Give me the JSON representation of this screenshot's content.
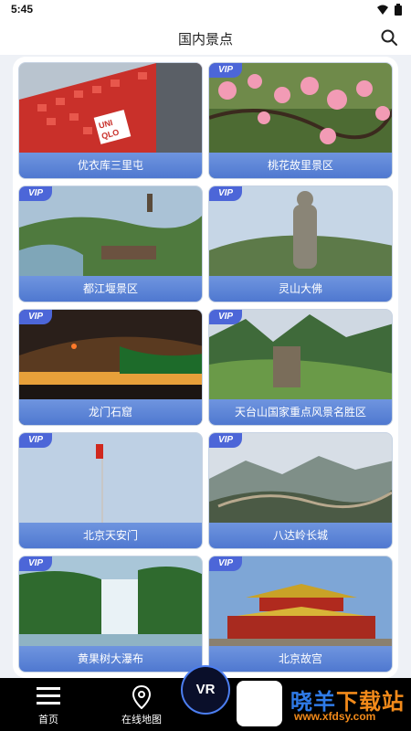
{
  "status_bar": {
    "time": "5:45"
  },
  "header": {
    "title": "国内景点"
  },
  "cards": [
    {
      "label": "优衣库三里屯",
      "vip": ""
    },
    {
      "label": "桃花故里景区",
      "vip": "VIP"
    },
    {
      "label": "都江堰景区",
      "vip": "VIP"
    },
    {
      "label": "灵山大佛",
      "vip": "VIP"
    },
    {
      "label": "龙门石窟",
      "vip": "VIP"
    },
    {
      "label": "天台山国家重点风景名胜区",
      "vip": "VIP"
    },
    {
      "label": "北京天安门",
      "vip": "VIP"
    },
    {
      "label": "八达岭长城",
      "vip": "VIP"
    },
    {
      "label": "黄果树大瀑布",
      "vip": "VIP"
    },
    {
      "label": "北京故宫",
      "vip": "VIP"
    }
  ],
  "nav": {
    "home": "首页",
    "map": "在线地图",
    "vr": "VR"
  },
  "watermark": {
    "text_a": "晓羊",
    "text_b": "下载站",
    "url": "www.xfdsy.com"
  }
}
